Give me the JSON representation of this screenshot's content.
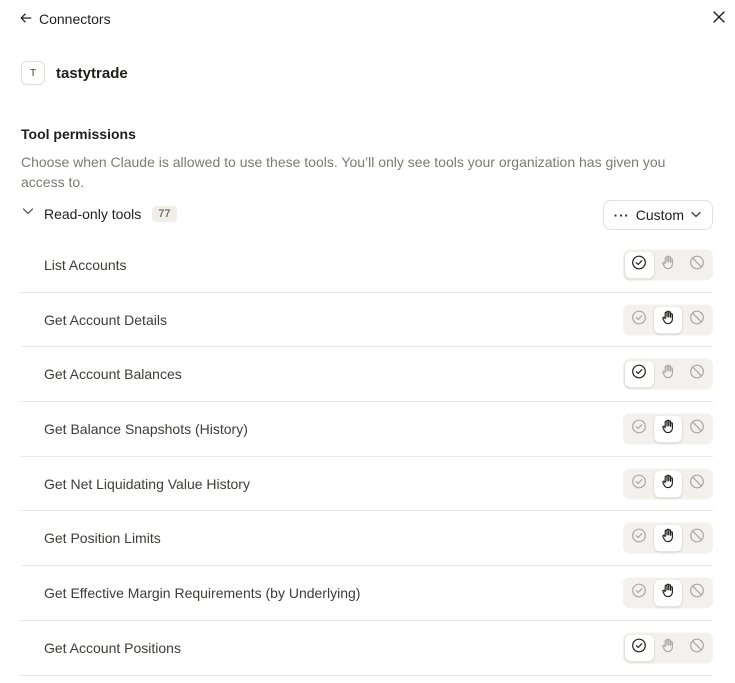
{
  "nav": {
    "back_label": "Connectors"
  },
  "app": {
    "logo_letter": "T",
    "name": "tastytrade"
  },
  "permissions": {
    "title": "Tool permissions",
    "description": "Choose when Claude is allowed to use these tools. You’ll only see tools your organization has given you access to."
  },
  "group": {
    "label": "Read-only tools",
    "count": "77",
    "mode_label": "Custom"
  },
  "tools": [
    {
      "name": "List Accounts",
      "permission": "always-allow"
    },
    {
      "name": "Get Account Details",
      "permission": "needs-approval"
    },
    {
      "name": "Get Account Balances",
      "permission": "always-allow"
    },
    {
      "name": "Get Balance Snapshots (History)",
      "permission": "needs-approval"
    },
    {
      "name": "Get Net Liquidating Value History",
      "permission": "needs-approval"
    },
    {
      "name": "Get Position Limits",
      "permission": "needs-approval"
    },
    {
      "name": "Get Effective Margin Requirements (by Underlying)",
      "permission": "needs-approval"
    },
    {
      "name": "Get Account Positions",
      "permission": "always-allow"
    }
  ],
  "colors": {
    "icon_active": "#1f1e1d",
    "icon_inactive": "#a9a7a0",
    "text_muted": "#7b7a75"
  }
}
